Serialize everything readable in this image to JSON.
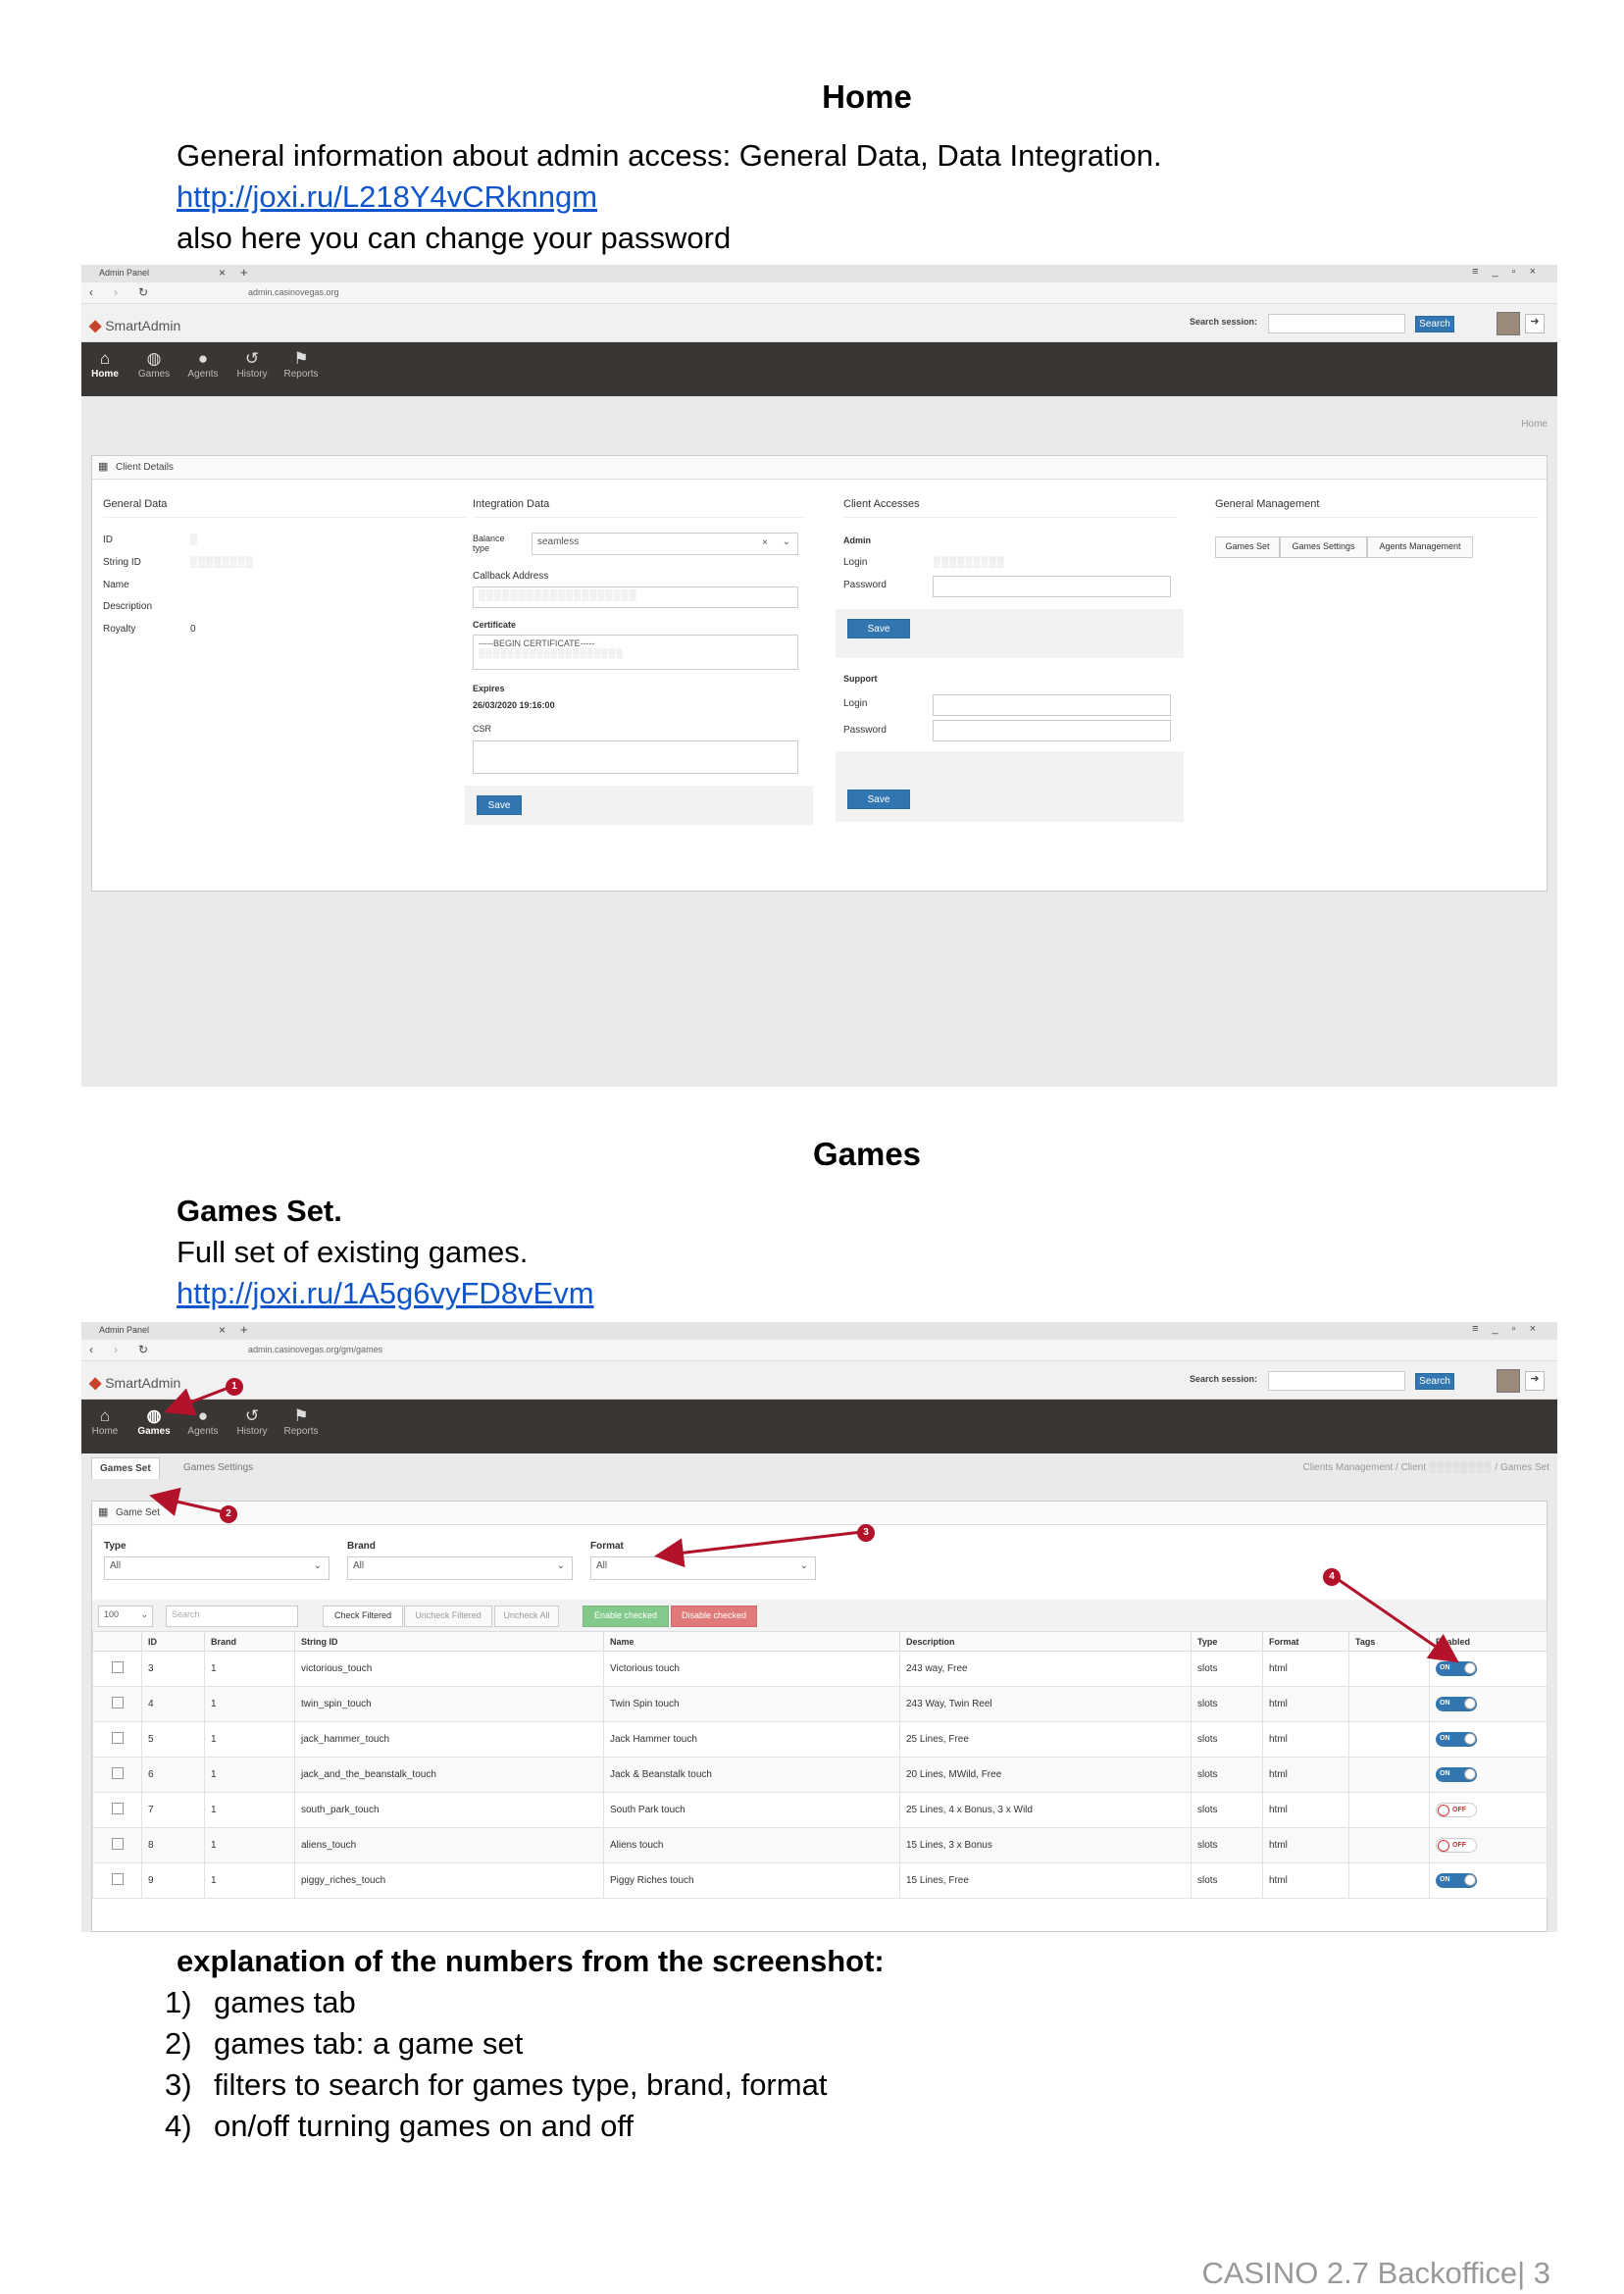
{
  "home": {
    "title": "Home",
    "line1": "General information about admin access: General Data, Data Integration.",
    "link": "http://joxi.ru/L218Y4vCRknngm",
    "line2": "also here you can change your password"
  },
  "shot1": {
    "tab_title": "Admin Panel",
    "url": "admin.casinovegas.org",
    "app_name": "SmartAdmin",
    "search_label": "Search session:",
    "search_button": "Search",
    "nav": [
      {
        "label": "Home",
        "icon": "home-icon",
        "active": true
      },
      {
        "label": "Games",
        "icon": "gamepad-icon",
        "active": false
      },
      {
        "label": "Agents",
        "icon": "user-icon",
        "active": false
      },
      {
        "label": "History",
        "icon": "history-icon",
        "active": false
      },
      {
        "label": "Reports",
        "icon": "flag-icon",
        "active": false
      }
    ],
    "breadcrumb": "Home",
    "panel_title": "Client Details",
    "general": {
      "heading": "General Data",
      "id_label": "ID",
      "string_id_label": "String ID",
      "name_label": "Name",
      "description_label": "Description",
      "royalty_label": "Royalty",
      "royalty_value": "0"
    },
    "integration": {
      "heading": "Integration Data",
      "balance_type_label": "Balance type",
      "balance_type_value": "seamless",
      "callback_label": "Callback Address",
      "certificate_label": "Certificate",
      "certificate_value": "-----BEGIN CERTIFICATE-----",
      "expires_label": "Expires",
      "expires_value": "26/03/2020 19:16:00",
      "csr_label": "CSR",
      "save": "Save"
    },
    "accesses": {
      "heading": "Client Accesses",
      "admin_heading": "Admin",
      "login_label": "Login",
      "password_label": "Password",
      "save": "Save",
      "support_heading": "Support",
      "support_login_label": "Login",
      "support_password_label": "Password",
      "support_save": "Save"
    },
    "management": {
      "heading": "General Management",
      "buttons": [
        "Games Set",
        "Games Settings",
        "Agents Management"
      ]
    }
  },
  "games": {
    "title": "Games",
    "subtitle": "Games Set.",
    "line1": "Full set of existing games.",
    "link": "http://joxi.ru/1A5g6vyFD8vEvm"
  },
  "shot2": {
    "tab_title": "Admin Panel",
    "url": "admin.casinovegas.org/gm/games",
    "app_name": "SmartAdmin",
    "search_label": "Search session:",
    "search_button": "Search",
    "nav": [
      {
        "label": "Home",
        "icon": "home-icon",
        "active": false
      },
      {
        "label": "Games",
        "icon": "gamepad-icon",
        "active": true
      },
      {
        "label": "Agents",
        "icon": "user-icon",
        "active": false
      },
      {
        "label": "History",
        "icon": "history-icon",
        "active": false
      },
      {
        "label": "Reports",
        "icon": "flag-icon",
        "active": false
      }
    ],
    "subtabs": [
      "Games Set",
      "Games Settings"
    ],
    "breadcrumb": [
      "Clients Management",
      "Client",
      "Games Set"
    ],
    "panel_title": "Game Set",
    "filters": [
      {
        "label": "Type",
        "value": "All"
      },
      {
        "label": "Brand",
        "value": "All"
      },
      {
        "label": "Format",
        "value": "All"
      }
    ],
    "page_size": "100",
    "search_placeholder": "Search",
    "actions": [
      "Check Filtered",
      "Uncheck Filtered",
      "Uncheck All"
    ],
    "enable_checked": "Enable checked",
    "disable_checked": "Disable checked",
    "columns": [
      "ID",
      "Brand",
      "String ID",
      "Name",
      "Description",
      "Type",
      "Format",
      "Tags",
      "Enabled"
    ],
    "rows": [
      {
        "id": "3",
        "brand": "1",
        "string_id": "victorious_touch",
        "name": "Victorious touch",
        "description": "243 way, Free",
        "type": "slots",
        "format": "html",
        "enabled": "ON"
      },
      {
        "id": "4",
        "brand": "1",
        "string_id": "twin_spin_touch",
        "name": "Twin Spin touch",
        "description": "243 Way, Twin Reel",
        "type": "slots",
        "format": "html",
        "enabled": "ON"
      },
      {
        "id": "5",
        "brand": "1",
        "string_id": "jack_hammer_touch",
        "name": "Jack Hammer touch",
        "description": "25 Lines, Free",
        "type": "slots",
        "format": "html",
        "enabled": "ON"
      },
      {
        "id": "6",
        "brand": "1",
        "string_id": "jack_and_the_beanstalk_touch",
        "name": "Jack & Beanstalk touch",
        "description": "20 Lines, MWild, Free",
        "type": "slots",
        "format": "html",
        "enabled": "ON"
      },
      {
        "id": "7",
        "brand": "1",
        "string_id": "south_park_touch",
        "name": "South Park touch",
        "description": "25 Lines, 4 x Bonus, 3 x Wild",
        "type": "slots",
        "format": "html",
        "enabled": "OFF"
      },
      {
        "id": "8",
        "brand": "1",
        "string_id": "aliens_touch",
        "name": "Aliens touch",
        "description": "15 Lines, 3 x Bonus",
        "type": "slots",
        "format": "html",
        "enabled": "OFF"
      },
      {
        "id": "9",
        "brand": "1",
        "string_id": "piggy_riches_touch",
        "name": "Piggy Riches touch",
        "description": "15 Lines, Free",
        "type": "slots",
        "format": "html",
        "enabled": "ON"
      }
    ],
    "markers": [
      "1",
      "2",
      "3",
      "4"
    ]
  },
  "explanation": {
    "heading": "explanation of the numbers from the screenshot:",
    "items": [
      {
        "num": "1)",
        "text": "games tab"
      },
      {
        "num": "2)",
        "text": "games tab: a game set"
      },
      {
        "num": "3)",
        "text": "filters to search for games type, brand, format"
      },
      {
        "num": "4)",
        "text": "on/off turning games on and off"
      }
    ]
  },
  "footer": "CASINO 2.7 Backoffice| 3",
  "colors": {
    "accent": "#3276b1",
    "nav_bg": "#3a3633",
    "marker": "#b3122b",
    "link": "#1155cc"
  }
}
